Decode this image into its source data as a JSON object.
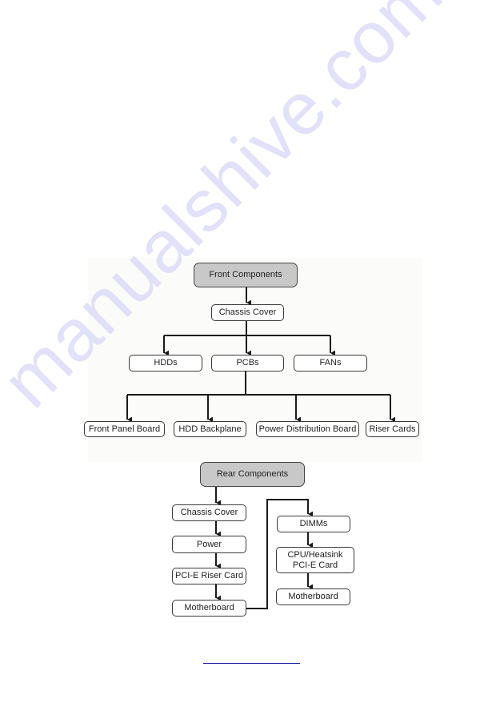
{
  "watermark": "manualshive.com",
  "front": {
    "root": "Front Components",
    "level1": "Chassis Cover",
    "level2": [
      "HDDs",
      "PCBs",
      "FANs"
    ],
    "level3": [
      "Front Panel Board",
      "HDD Backplane",
      "Power Distribution Board",
      "Riser Cards"
    ]
  },
  "rear": {
    "root": "Rear Components",
    "left_column": [
      "Chassis Cover",
      "Power",
      "PCI-E Riser Card",
      "Motherboard"
    ],
    "right_column": [
      "DIMMs",
      "CPU/Heatsink\nPCI-E Card",
      "Motherboard"
    ]
  },
  "footer": {
    "link_text": ""
  },
  "colors": {
    "root_fill": "#c8c8c8",
    "watermark": "#dcdcfa",
    "link": "#1a1aa0"
  }
}
